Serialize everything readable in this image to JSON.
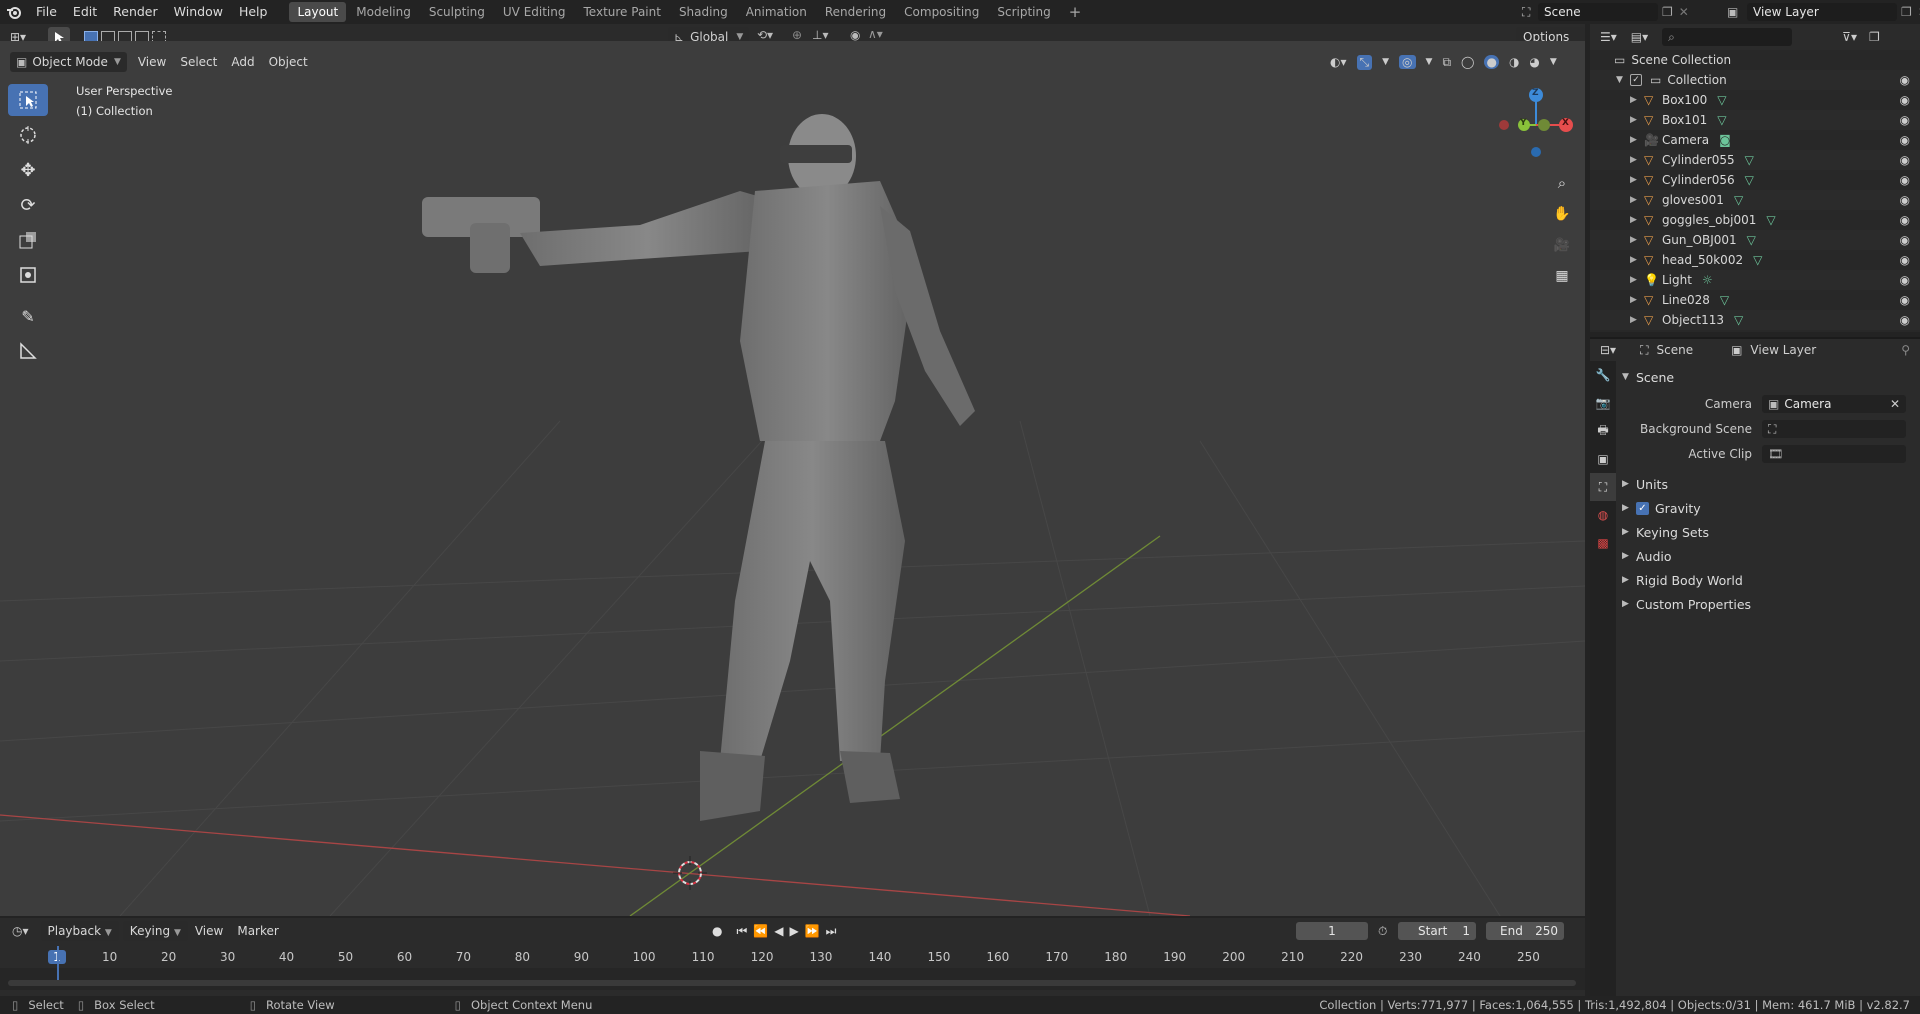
{
  "topbar": {
    "menus": [
      "File",
      "Edit",
      "Render",
      "Window",
      "Help"
    ],
    "workspaces": [
      "Layout",
      "Modeling",
      "Sculpting",
      "UV Editing",
      "Texture Paint",
      "Shading",
      "Animation",
      "Rendering",
      "Compositing",
      "Scripting"
    ],
    "active_workspace": "Layout",
    "add_workspace": "+",
    "scene_name": "Scene",
    "view_layer_name": "View Layer"
  },
  "tool_header": {
    "transform_orientation": "Global",
    "options_label": "Options"
  },
  "viewport_header": {
    "mode": "Object Mode",
    "menus": [
      "View",
      "Select",
      "Add",
      "Object"
    ]
  },
  "viewport": {
    "perspective_label": "User Perspective",
    "collection_label": "(1) Collection",
    "gizmo": {
      "x": "X",
      "y": "Y",
      "z": "Z"
    }
  },
  "outliner": {
    "root": "Scene Collection",
    "collection": "Collection",
    "items": [
      {
        "name": "Box100",
        "type": "mesh"
      },
      {
        "name": "Box101",
        "type": "mesh"
      },
      {
        "name": "Camera",
        "type": "camera"
      },
      {
        "name": "Cylinder055",
        "type": "mesh"
      },
      {
        "name": "Cylinder056",
        "type": "mesh"
      },
      {
        "name": "gloves001",
        "type": "mesh"
      },
      {
        "name": "goggles_obj001",
        "type": "mesh"
      },
      {
        "name": "Gun_OBJ001",
        "type": "mesh"
      },
      {
        "name": "head_50k002",
        "type": "mesh"
      },
      {
        "name": "Light",
        "type": "light"
      },
      {
        "name": "Line028",
        "type": "mesh"
      },
      {
        "name": "Object113",
        "type": "mesh"
      }
    ]
  },
  "properties": {
    "breadcrumb_scene": "Scene",
    "breadcrumb_view_layer": "View Layer",
    "panel_title": "Scene",
    "fields": {
      "camera_label": "Camera",
      "camera_value": "Camera",
      "background_scene_label": "Background Scene",
      "active_clip_label": "Active Clip"
    },
    "sections": [
      "Units",
      "Gravity",
      "Keying Sets",
      "Audio",
      "Rigid Body World",
      "Custom Properties"
    ],
    "gravity_checked": true
  },
  "timeline": {
    "menus": [
      "Playback",
      "Keying",
      "View",
      "Marker"
    ],
    "current_frame": "1",
    "start_label": "Start",
    "start_value": "1",
    "end_label": "End",
    "end_value": "250",
    "ruler_ticks": [
      "1",
      "10",
      "20",
      "30",
      "40",
      "50",
      "60",
      "70",
      "80",
      "90",
      "100",
      "110",
      "120",
      "130",
      "140",
      "150",
      "160",
      "170",
      "180",
      "190",
      "200",
      "210",
      "220",
      "230",
      "240",
      "250"
    ]
  },
  "statusbar": {
    "select": "Select",
    "box_select": "Box Select",
    "rotate_view": "Rotate View",
    "context_menu": "Object Context Menu",
    "stats": "Collection | Verts:771,977 | Faces:1,064,555 | Tris:1,492,804 | Objects:0/31 | Mem: 461.7 MiB | v2.82.7"
  },
  "colors": {
    "accent": "#4772b3",
    "mesh_icon": "#e39a4a",
    "data_icon": "#6cc49a",
    "axis_x": "#e64d4d",
    "axis_y": "#8ac23a",
    "axis_z": "#3d8bd9"
  }
}
